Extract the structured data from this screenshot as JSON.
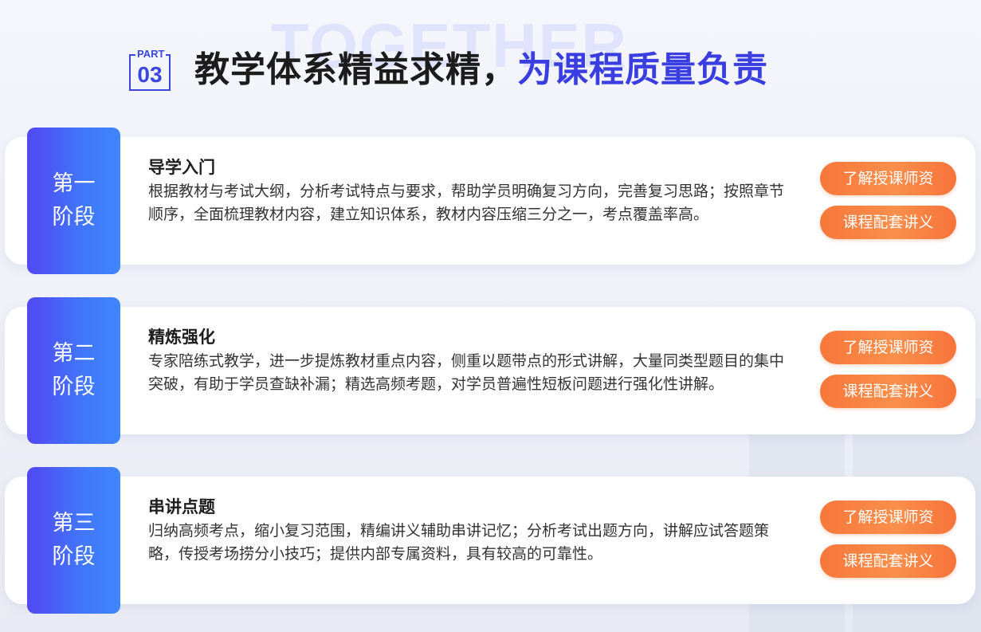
{
  "watermark": "TOGETHER",
  "header": {
    "part_label": "PART",
    "part_number": "03",
    "title_main": "教学体系精益求精，",
    "title_accent": "为课程质量负责"
  },
  "stages": [
    {
      "tab_line1": "第一",
      "tab_line2": "阶段",
      "title": "导学入门",
      "description": "根据教材与考试大纲，分析考试特点与要求，帮助学员明确复习方向，完善复习思路；按照章节顺序，全面梳理教材内容，建立知识体系，教材内容压缩三分之一，考点覆盖率高。",
      "button_teachers": "了解授课师资",
      "button_materials": "课程配套讲义"
    },
    {
      "tab_line1": "第二",
      "tab_line2": "阶段",
      "title": "精炼强化",
      "description": "专家陪练式教学，进一步提炼教材重点内容，侧重以题带点的形式讲解，大量同类型题目的集中突破，有助于学员查缺补漏；精选高频考题，对学员普遍性短板问题进行强化性讲解。",
      "button_teachers": "了解授课师资",
      "button_materials": "课程配套讲义"
    },
    {
      "tab_line1": "第三",
      "tab_line2": "阶段",
      "title": "串讲点题",
      "description": "归纳高频考点，缩小复习范围，精编讲义辅助串讲记忆；分析考试出题方向，讲解应试答题策略，传授考场捞分小技巧；提供内部专属资料，具有较高的可靠性。",
      "button_teachers": "了解授课师资",
      "button_materials": "课程配套讲义"
    }
  ],
  "colors": {
    "accent_blue": "#3a3ee0",
    "tab_gradient_start": "#5248f2",
    "tab_gradient_end": "#3f86fd",
    "button_orange": "#f7773a"
  }
}
